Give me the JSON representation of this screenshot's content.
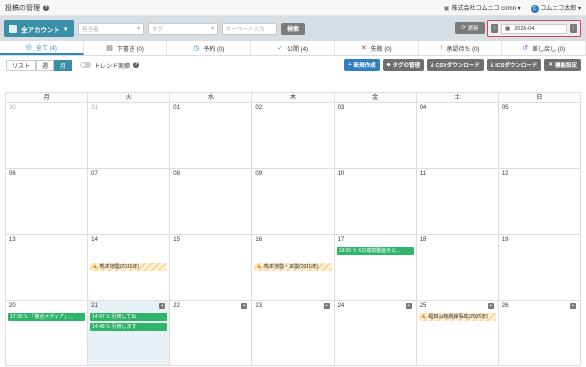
{
  "header": {
    "title": "投稿の管理",
    "company": "株式会社コムニコ comn",
    "user": "コムニコ太郎"
  },
  "filters": {
    "account": "全アカウント",
    "author_placeholder": "担当者",
    "tag_placeholder": "タグ",
    "keyword_placeholder": "キーワード入力",
    "search_label": "検索",
    "refresh_label": "更新",
    "date_value": "2026-04"
  },
  "tabs": [
    {
      "icon": "◎",
      "label": "全て (4)"
    },
    {
      "icon": "▤",
      "label": "下書き (0)"
    },
    {
      "icon": "◷",
      "label": "予約 (0)"
    },
    {
      "icon": "✓",
      "label": "公開 (4)"
    },
    {
      "icon": "✕",
      "label": "失敗 (0)"
    },
    {
      "icon": "!",
      "label": "承認待ち (0)"
    },
    {
      "icon": "↺",
      "label": "差し戻し (0)"
    }
  ],
  "view": {
    "list": "リスト",
    "week": "週",
    "month": "月",
    "trend": "トレンド実績"
  },
  "actions": {
    "new": "新規作成",
    "tags": "タグの管理",
    "csv": "CSVダウンロード",
    "ics": "ICSダウンロード",
    "settings": "機能設定"
  },
  "calendar": {
    "weekdays": [
      "月",
      "火",
      "水",
      "木",
      "金",
      "土",
      "日"
    ],
    "weeks": [
      [
        "30",
        "31",
        "01",
        "02",
        "03",
        "04",
        "05"
      ],
      [
        "06",
        "07",
        "08",
        "09",
        "10",
        "11",
        "12"
      ],
      [
        "13",
        "14",
        "15",
        "16",
        "17",
        "18",
        "19"
      ],
      [
        "20",
        "21",
        "22",
        "23",
        "24",
        "25",
        "26"
      ]
    ],
    "events": {
      "w2d1": "熊本地震(2016年)",
      "w2d3": "熊本地震・本震(2016年)",
      "w2d4": "18:00 𝕏 Xの複数動画を公...",
      "w3d0": "17:30 𝕏 「複合メディア」...",
      "w3d1a": "14:47 𝕏 引用してね",
      "w3d1b": "14:48 𝕏 引用します",
      "w3d5": "福知山線脱線事故(2005年)"
    }
  },
  "colors": {
    "accent": "#3a8ea8",
    "green": "#2fb46a",
    "highlight": "#e33b5a"
  }
}
